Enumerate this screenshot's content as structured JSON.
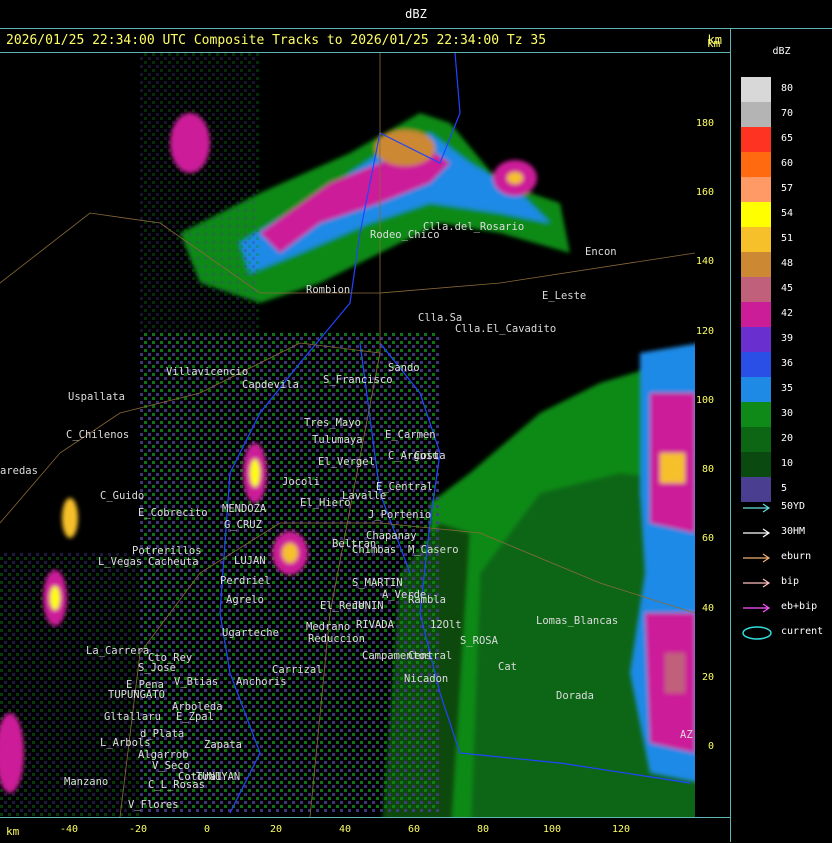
{
  "top_label": "dBZ",
  "header": {
    "title": "2026/01/25 22:34:00 UTC Composite Tracks to 2026/01/25 22:34:00 Tz 35",
    "unit": "km"
  },
  "y_axis": {
    "unit": "km",
    "ticks": [
      "180",
      "160",
      "140",
      "120",
      "100",
      "80",
      "60",
      "40",
      "20",
      "0"
    ]
  },
  "x_axis": {
    "unit": "km",
    "ticks": [
      "-40",
      "-20",
      "0",
      "20",
      "40",
      "60",
      "80",
      "100",
      "120"
    ]
  },
  "legend": {
    "title": "dBZ",
    "levels": [
      {
        "label": "80",
        "color": "#d8d8d8"
      },
      {
        "label": "70",
        "color": "#b4b4b4"
      },
      {
        "label": "65",
        "color": "#ff3322"
      },
      {
        "label": "60",
        "color": "#ff6a10"
      },
      {
        "label": "57",
        "color": "#ff9966"
      },
      {
        "label": "54",
        "color": "#ffff00"
      },
      {
        "label": "51",
        "color": "#f6c02a"
      },
      {
        "label": "48",
        "color": "#cc8833"
      },
      {
        "label": "45",
        "color": "#c0607a"
      },
      {
        "label": "42",
        "color": "#cc1d99"
      },
      {
        "label": "39",
        "color": "#6a2fcf"
      },
      {
        "label": "36",
        "color": "#2a4fe6"
      },
      {
        "label": "35",
        "color": "#1e8ae6"
      },
      {
        "label": "30",
        "color": "#0f8a18"
      },
      {
        "label": "20",
        "color": "#0c6614"
      },
      {
        "label": "10",
        "color": "#0a4a10"
      },
      {
        "label": "5",
        "color": "#4a3e90"
      }
    ],
    "tracks": [
      {
        "label": "50YD",
        "color": "#66dddd"
      },
      {
        "label": "30HM",
        "color": "#ffffff"
      },
      {
        "label": "eburn",
        "color": "#f0b070"
      },
      {
        "label": "bip",
        "color": "#ffc0c0"
      },
      {
        "label": "eb+bip",
        "color": "#ff55ff"
      },
      {
        "label": "current",
        "color": "#33dddd"
      }
    ]
  },
  "places": [
    {
      "name": "Clla.del_Rosario"
    },
    {
      "name": "Encon"
    },
    {
      "name": "Rodeo_Chico"
    },
    {
      "name": "Rombion"
    },
    {
      "name": "E_Leste"
    },
    {
      "name": "Clla.Sa"
    },
    {
      "name": "Clla.El_Cavadito"
    },
    {
      "name": "Sando"
    },
    {
      "name": "Villavicencio"
    },
    {
      "name": "Uspallata"
    },
    {
      "name": "Capdevila"
    },
    {
      "name": "S_Francisco"
    },
    {
      "name": "Tres_Mayo"
    },
    {
      "name": "Tulumaya"
    },
    {
      "name": "E_Carmen"
    },
    {
      "name": "C_Chilenos"
    },
    {
      "name": "aredas"
    },
    {
      "name": "Jocoli"
    },
    {
      "name": "El_Vergel"
    },
    {
      "name": "C_Arguiu"
    },
    {
      "name": "Costa"
    },
    {
      "name": "E_Central"
    },
    {
      "name": "C_Guido"
    },
    {
      "name": "E_Cobrecito"
    },
    {
      "name": "MENDOZA"
    },
    {
      "name": "El_Hiero"
    },
    {
      "name": "Lavalle"
    },
    {
      "name": "G_CRUZ"
    },
    {
      "name": "J_Portenio"
    },
    {
      "name": "Chapanay"
    },
    {
      "name": "Beltran"
    },
    {
      "name": "Chimbas"
    },
    {
      "name": "M_Casero"
    },
    {
      "name": "Potrerillos"
    },
    {
      "name": "L_Vegas"
    },
    {
      "name": "Cacheuta"
    },
    {
      "name": "LUJAN"
    },
    {
      "name": "Perdriel"
    },
    {
      "name": "S_MARTIN"
    },
    {
      "name": "JUNIN"
    },
    {
      "name": "Agrelo"
    },
    {
      "name": "A_Verde"
    },
    {
      "name": "Rambla"
    },
    {
      "name": "El_Rene"
    },
    {
      "name": "RIVADA"
    },
    {
      "name": "Ugarteche"
    },
    {
      "name": "Medrano"
    },
    {
      "name": "Reduccion"
    },
    {
      "name": "12Olt"
    },
    {
      "name": "Lomas_Blancas"
    },
    {
      "name": "S_ROSA"
    },
    {
      "name": "La_Carrera"
    },
    {
      "name": "Cto_Rey"
    },
    {
      "name": "S_Jose"
    },
    {
      "name": "Carrizal"
    },
    {
      "name": "Campamentos"
    },
    {
      "name": "Central"
    },
    {
      "name": "Cat"
    },
    {
      "name": "E_Pena"
    },
    {
      "name": "V_Btias"
    },
    {
      "name": "Anchoris"
    },
    {
      "name": "TUPUNGATO"
    },
    {
      "name": "Nicadon"
    },
    {
      "name": "Dorada"
    },
    {
      "name": "Arboleda"
    },
    {
      "name": "Gltallaru"
    },
    {
      "name": "E_Zpal"
    },
    {
      "name": "d_Plata"
    },
    {
      "name": "L_Arbols"
    },
    {
      "name": "Zapata"
    },
    {
      "name": "Algarrob"
    },
    {
      "name": "V_Seco"
    },
    {
      "name": "Cotoral"
    },
    {
      "name": "TUNUYAN"
    },
    {
      "name": "Manzano"
    },
    {
      "name": "C_L_Rosas"
    },
    {
      "name": "V_Flores"
    },
    {
      "name": "AZ"
    }
  ]
}
